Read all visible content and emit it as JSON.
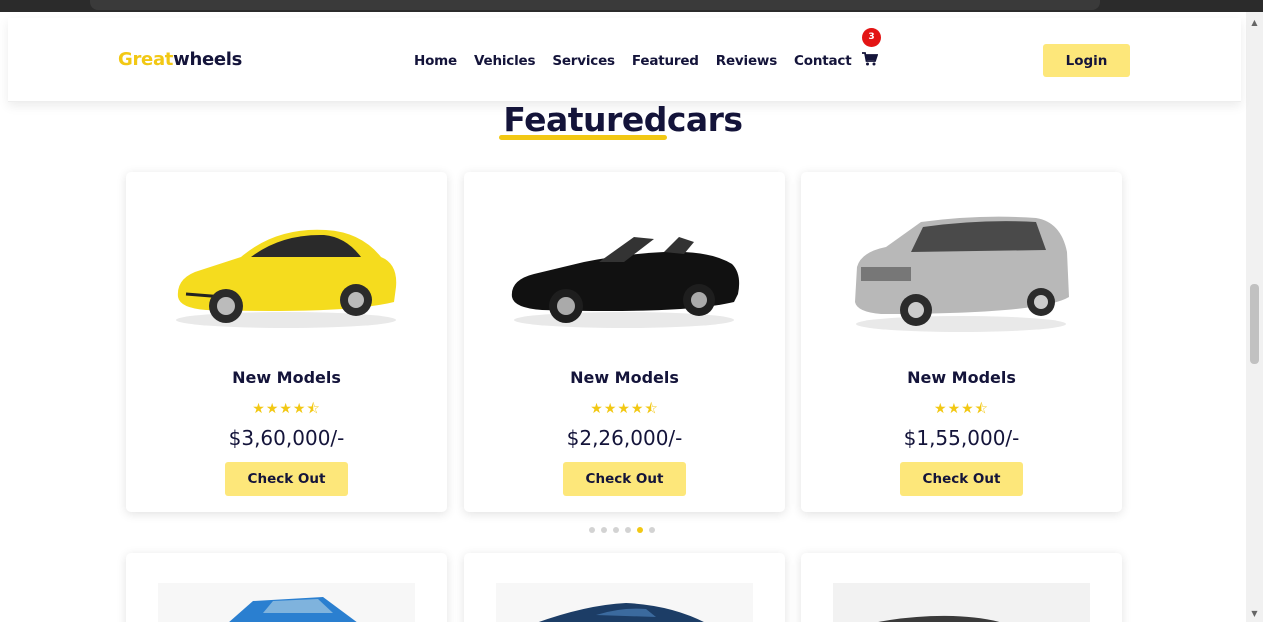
{
  "navbar": {
    "logo_accent": "Great",
    "logo_main": "wheels",
    "links": [
      "Home",
      "Vehicles",
      "Services",
      "Featured",
      "Reviews",
      "Contact"
    ],
    "cart_count": "3",
    "cart_icon": "shopping-cart-icon",
    "login_label": "Login"
  },
  "section": {
    "title": "Featuredcars"
  },
  "cards": [
    {
      "model": "New Models",
      "rating_stars": "★★★★⯪",
      "rating": 4.5,
      "price": "$3,60,000/-",
      "button": "Check Out",
      "car_color": "#f5dc1e",
      "car_icon": "yellow-sports-car-image"
    },
    {
      "model": "New Models",
      "rating_stars": "★★★★⯪",
      "rating": 4.5,
      "price": "$2,26,000/-",
      "button": "Check Out",
      "car_color": "#111111",
      "car_icon": "black-convertible-car-image"
    },
    {
      "model": "New Models",
      "rating_stars": "★★★⯪",
      "rating": 3.5,
      "price": "$1,55,000/-",
      "button": "Check Out",
      "car_color": "#b8b8b8",
      "car_icon": "silver-suv-car-image"
    }
  ],
  "carousel": {
    "dot_count": 6,
    "active_index": 4
  },
  "colors": {
    "accent": "#f2c814",
    "button_bg": "#fde77a",
    "text_dark": "#14143a",
    "badge_red": "#e31414"
  }
}
